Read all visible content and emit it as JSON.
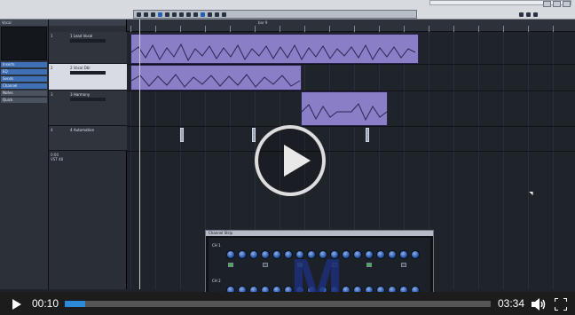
{
  "window": {
    "menu": [
      "",
      "",
      "",
      "",
      "",
      "",
      "",
      "",
      "",
      "",
      "",
      ""
    ],
    "ruler_label": "bar 9"
  },
  "tracks": [
    {
      "num": "1",
      "name": "1 Lead Vocal",
      "selected": false
    },
    {
      "num": "2",
      "name": "2 Vocal Dbl",
      "selected": true
    },
    {
      "num": "3",
      "name": "3 Harmony",
      "selected": false
    },
    {
      "num": "4",
      "name": "4 Automation",
      "selected": false
    }
  ],
  "tracklist_footer": [
    "0:00",
    "VST 48"
  ],
  "inspector": {
    "header": "Vocal",
    "sections": [
      "Inserts",
      "EQ",
      "Sends",
      "Channel",
      "Notes",
      "Quick"
    ]
  },
  "plugin": {
    "title": "Channel Strip",
    "rows": [
      "CH 1",
      "CH 2"
    ],
    "watermark": "M"
  },
  "background_watermark": "M",
  "player": {
    "current_time": "00:10",
    "total_time": "03:34",
    "progress": 0.047
  },
  "colors": {
    "clip_purple": "#8878c0",
    "progress_blue": "#2b8bd9"
  }
}
